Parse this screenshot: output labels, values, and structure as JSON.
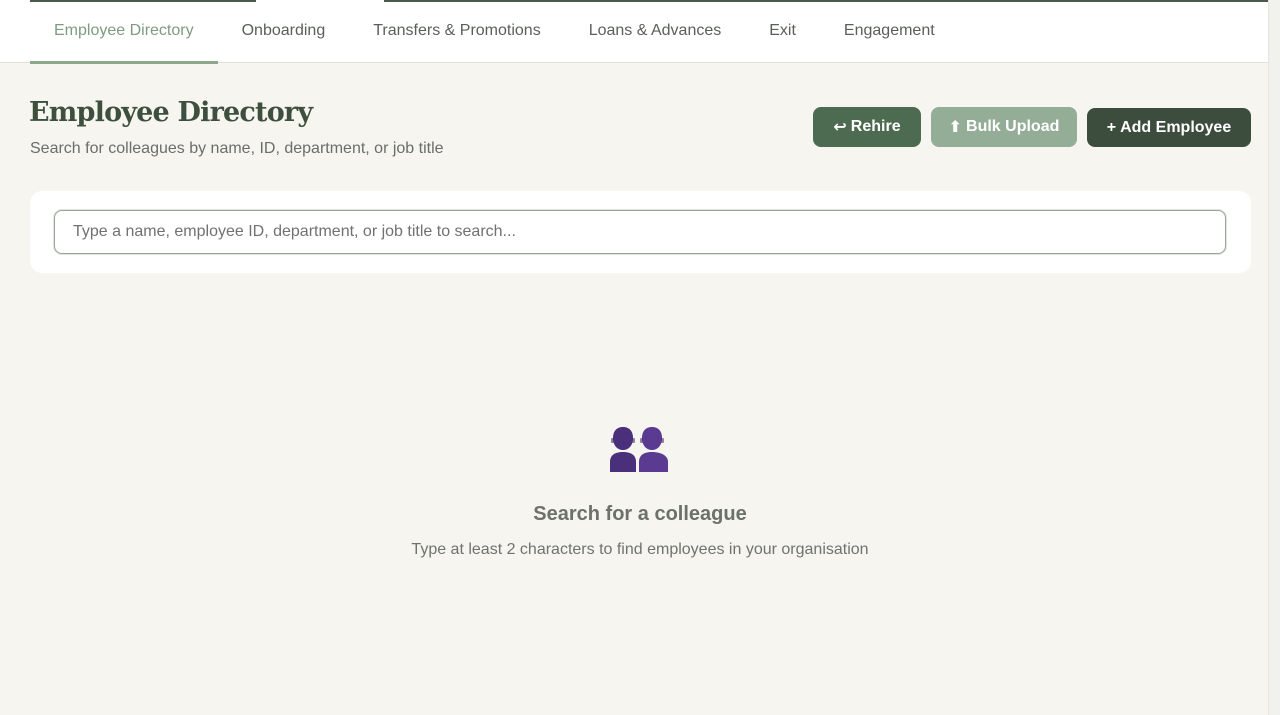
{
  "nav": {
    "tabs": [
      {
        "label": "Employee Directory",
        "active": true
      },
      {
        "label": "Onboarding",
        "active": false
      },
      {
        "label": "Transfers & Promotions",
        "active": false
      },
      {
        "label": "Loans & Advances",
        "active": false
      },
      {
        "label": "Exit",
        "active": false
      },
      {
        "label": "Engagement",
        "active": false
      }
    ]
  },
  "header": {
    "title": "Employee Directory",
    "subtitle": "Search for colleagues by name, ID, department, or job title"
  },
  "actions": {
    "rehire": {
      "icon": "↩",
      "label": "Rehire"
    },
    "bulk_upload": {
      "icon": "⬆",
      "label": "Bulk Upload"
    },
    "add_employee": {
      "icon": "+",
      "label": "Add Employee"
    }
  },
  "search": {
    "value": "",
    "placeholder": "Type a name, employee ID, department, or job title to search..."
  },
  "empty_state": {
    "icon": "two-people-icon",
    "title": "Search for a colleague",
    "subtitle": "Type at least 2 characters to find employees in your organisation"
  },
  "colors": {
    "accent": "#8ea88f",
    "primary_dark": "#3c4c3d",
    "primary": "#4d6b50",
    "primary_light": "#94ad96",
    "background": "#f6f5f0"
  }
}
